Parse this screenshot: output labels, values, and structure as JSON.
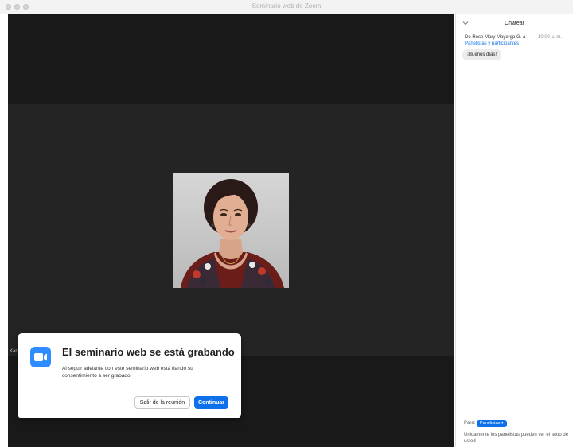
{
  "window": {
    "title": "Seminario web de Zoom"
  },
  "video": {
    "participant_label": "Kar",
    "portrait_icon": "participant-photo"
  },
  "recording_dialog": {
    "icon": "zoom-camera-icon",
    "title": "El seminario web se está grabando",
    "message": "Al seguir adelante con este seminario web está dando su consentimiento a ser grabado.",
    "leave_label": "Salir de la reunión",
    "continue_label": "Continuar"
  },
  "chat": {
    "title": "Chatear",
    "message": {
      "from": "De Rose Mary Mayorga G. a",
      "to": "Panelistas y participantes",
      "time": "10:02 a. m.",
      "text": "¡Buenos días!"
    },
    "to_label": "Para:",
    "to_value": "Panelistas",
    "note": "Únicamente los panelistas pueden ver el texto de usted"
  },
  "colors": {
    "accent": "#0e71eb",
    "zoom_blue": "#2d8cff",
    "stage": "#242424",
    "stage_dark": "#191919"
  }
}
